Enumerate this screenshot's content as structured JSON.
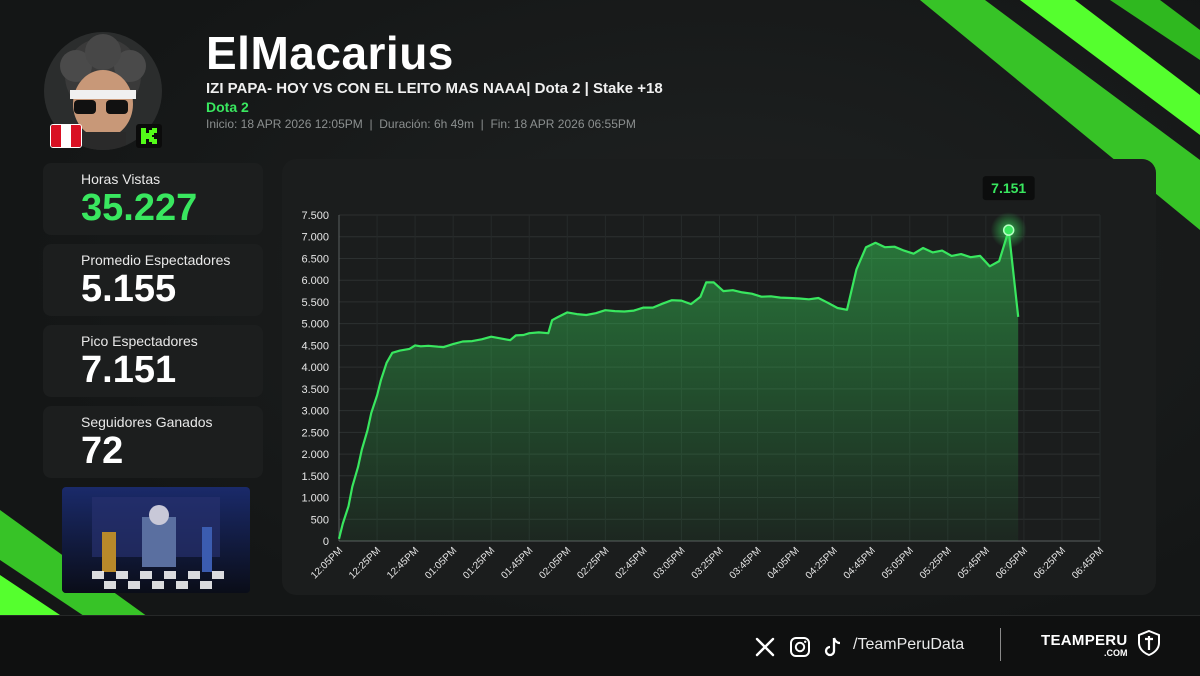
{
  "streamer": {
    "name": "ElMacarius",
    "stream_title": "IZI PAPA- HOY VS CON EL LEITO MAS NAAA| Dota 2 | Stake +18",
    "game": "Dota 2",
    "times": {
      "inicio": "Inicio: 18 APR 2026 12:05PM",
      "duracion": "Duración: 6h 49m",
      "fin": "Fin: 18 APR 2026 06:55PM",
      "separator": "|"
    }
  },
  "stats": [
    {
      "label": "Horas Vistas",
      "value": "35.227"
    },
    {
      "label": "Promedio Espectadores",
      "value": "5.155"
    },
    {
      "label": "Pico Espectadores",
      "value": "7.151"
    },
    {
      "label": "Seguidores Ganados",
      "value": "72"
    }
  ],
  "footer": {
    "handle": "/TeamPeruData",
    "brand": "TEAMPERU",
    "brand_suffix": ".COM",
    "social_icons": [
      "x-icon",
      "instagram-icon",
      "tiktok-icon"
    ]
  },
  "colors": {
    "accent": "#39e75f",
    "line": "#39e75f",
    "flag_red": "#d91023",
    "kick_green": "#53fc18"
  },
  "chart_data": {
    "type": "area",
    "ylim": [
      0,
      7500
    ],
    "y_ticks": [
      "0",
      "500",
      "1.000",
      "1.500",
      "2.000",
      "2.500",
      "3.000",
      "3.500",
      "4.000",
      "4.500",
      "5.000",
      "5.500",
      "6.000",
      "6.500",
      "7.000",
      "7.500"
    ],
    "x_ticks": [
      "12:05PM",
      "12:25PM",
      "12:45PM",
      "01:05PM",
      "01:25PM",
      "01:45PM",
      "02:05PM",
      "02:25PM",
      "02:45PM",
      "03:05PM",
      "03:25PM",
      "03:45PM",
      "04:05PM",
      "04:25PM",
      "04:45PM",
      "05:05PM",
      "05:25PM",
      "05:45PM",
      "06:05PM",
      "06:25PM",
      "06:45PM"
    ],
    "x_start": "12:05PM",
    "x_end": "06:45PM",
    "peak_label": "7.151",
    "grid": true,
    "series": [
      {
        "points": [
          [
            "12:05PM",
            50
          ],
          [
            "12:07PM",
            400
          ],
          [
            "12:10PM",
            800
          ],
          [
            "12:12PM",
            1250
          ],
          [
            "12:15PM",
            1700
          ],
          [
            "12:17PM",
            2100
          ],
          [
            "12:20PM",
            2550
          ],
          [
            "12:22PM",
            2950
          ],
          [
            "12:25PM",
            3350
          ],
          [
            "12:27PM",
            3700
          ],
          [
            "12:30PM",
            4100
          ],
          [
            "12:33PM",
            4330
          ],
          [
            "12:37PM",
            4380
          ],
          [
            "12:42PM",
            4420
          ],
          [
            "12:45PM",
            4500
          ],
          [
            "12:48PM",
            4480
          ],
          [
            "12:52PM",
            4490
          ],
          [
            "12:57PM",
            4470
          ],
          [
            "01:00PM",
            4460
          ],
          [
            "01:05PM",
            4530
          ],
          [
            "01:10PM",
            4590
          ],
          [
            "01:15PM",
            4600
          ],
          [
            "01:20PM",
            4640
          ],
          [
            "01:25PM",
            4700
          ],
          [
            "01:30PM",
            4660
          ],
          [
            "01:35PM",
            4620
          ],
          [
            "01:38PM",
            4730
          ],
          [
            "01:42PM",
            4740
          ],
          [
            "01:45PM",
            4780
          ],
          [
            "01:50PM",
            4800
          ],
          [
            "01:55PM",
            4780
          ],
          [
            "01:57PM",
            5080
          ],
          [
            "02:00PM",
            5150
          ],
          [
            "02:05PM",
            5260
          ],
          [
            "02:10PM",
            5220
          ],
          [
            "02:15PM",
            5200
          ],
          [
            "02:20PM",
            5240
          ],
          [
            "02:25PM",
            5310
          ],
          [
            "02:30PM",
            5290
          ],
          [
            "02:35PM",
            5280
          ],
          [
            "02:40PM",
            5300
          ],
          [
            "02:45PM",
            5370
          ],
          [
            "02:50PM",
            5370
          ],
          [
            "02:55PM",
            5460
          ],
          [
            "03:00PM",
            5540
          ],
          [
            "03:05PM",
            5530
          ],
          [
            "03:10PM",
            5450
          ],
          [
            "03:15PM",
            5620
          ],
          [
            "03:18PM",
            5950
          ],
          [
            "03:22PM",
            5950
          ],
          [
            "03:27PM",
            5750
          ],
          [
            "03:32PM",
            5770
          ],
          [
            "03:37PM",
            5720
          ],
          [
            "03:42PM",
            5690
          ],
          [
            "03:47PM",
            5620
          ],
          [
            "03:52PM",
            5630
          ],
          [
            "03:57PM",
            5600
          ],
          [
            "04:02PM",
            5590
          ],
          [
            "04:07PM",
            5580
          ],
          [
            "04:12PM",
            5560
          ],
          [
            "04:17PM",
            5590
          ],
          [
            "04:22PM",
            5480
          ],
          [
            "04:27PM",
            5360
          ],
          [
            "04:32PM",
            5320
          ],
          [
            "04:37PM",
            6250
          ],
          [
            "04:42PM",
            6760
          ],
          [
            "04:47PM",
            6860
          ],
          [
            "04:52PM",
            6760
          ],
          [
            "04:57PM",
            6770
          ],
          [
            "05:02PM",
            6680
          ],
          [
            "05:07PM",
            6610
          ],
          [
            "05:12PM",
            6740
          ],
          [
            "05:17PM",
            6640
          ],
          [
            "05:22PM",
            6680
          ],
          [
            "05:27PM",
            6560
          ],
          [
            "05:32PM",
            6600
          ],
          [
            "05:37PM",
            6530
          ],
          [
            "05:42PM",
            6560
          ],
          [
            "05:47PM",
            6320
          ],
          [
            "05:52PM",
            6440
          ],
          [
            "05:57PM",
            7151
          ],
          [
            "06:02PM",
            5155
          ]
        ]
      }
    ]
  }
}
